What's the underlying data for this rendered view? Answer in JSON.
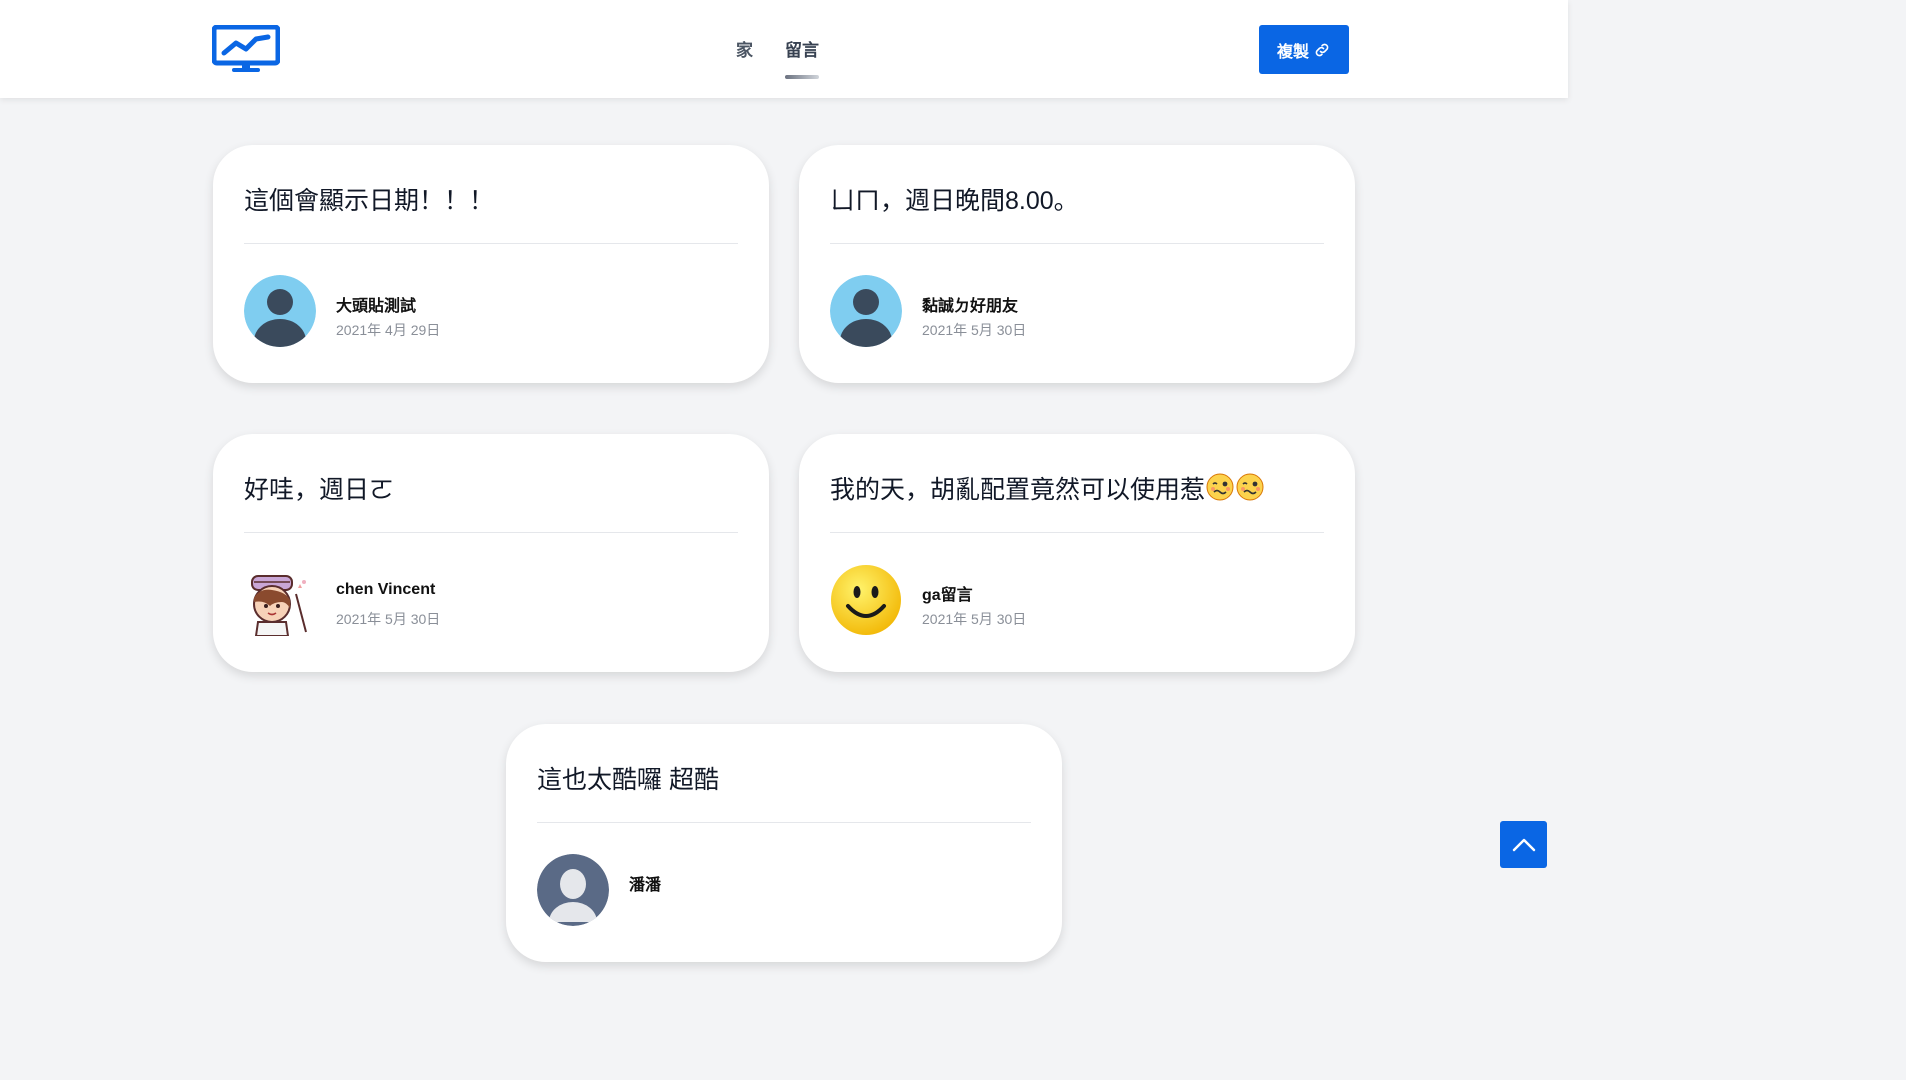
{
  "header": {
    "nav": [
      {
        "label": "家",
        "active": false
      },
      {
        "label": "留言",
        "active": true
      }
    ],
    "copy_label": "複製"
  },
  "colors": {
    "accent": "#0a66e4",
    "background": "#f3f4f6",
    "card": "#ffffff"
  },
  "comments": [
    {
      "title": "這個會顯示日期！！！",
      "author": "大頭貼測試",
      "date": "2021年 4月 29日",
      "avatar": "default-silhouette"
    },
    {
      "title": "ㄩㄇ，週日晚間8.00。",
      "author": "黏誠ㄉ好朋友",
      "date": "2021年 5月 30日",
      "avatar": "default-silhouette"
    },
    {
      "title": "好哇，週日ㄛ",
      "author": "chen Vincent",
      "date": "2021年 5月 30日",
      "avatar": "cartoon-character"
    },
    {
      "title": "我的天，胡亂配置竟然可以使用惹",
      "author": "ga留言",
      "date": "2021年 5月 30日",
      "avatar": "smiley-face"
    },
    {
      "title": "這也太酷囉 超酷",
      "author": "潘潘",
      "date": "",
      "avatar": "gray-silhouette"
    }
  ]
}
